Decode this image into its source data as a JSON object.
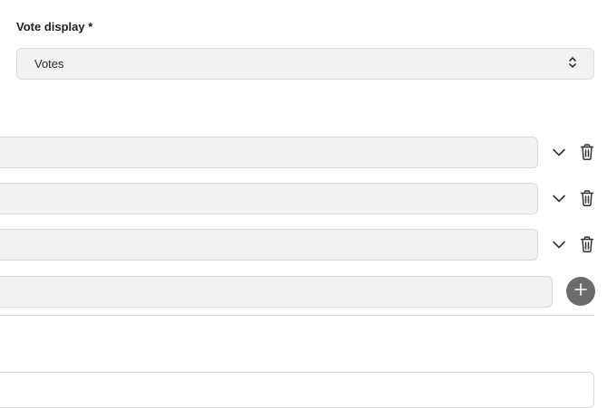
{
  "vote_display": {
    "label": "Vote display *",
    "selected": "Votes",
    "chevron_icon": "up-down-chevron-icon"
  },
  "options": [
    {
      "value": "",
      "expand_icon": "chevron-down-icon",
      "delete_icon": "trash-icon"
    },
    {
      "value": "",
      "expand_icon": "chevron-down-icon",
      "delete_icon": "trash-icon"
    },
    {
      "value": "",
      "expand_icon": "chevron-down-icon",
      "delete_icon": "trash-icon"
    }
  ],
  "new_option": {
    "value": "",
    "add_icon": "plus-icon"
  },
  "colors": {
    "field_bg": "#f2f2f2",
    "border": "#d9d9d9",
    "add_button": "#6b6b6b",
    "icon": "#333333"
  }
}
